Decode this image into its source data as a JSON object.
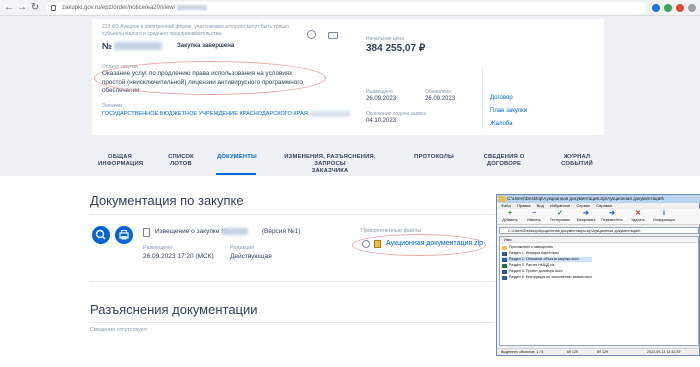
{
  "browser": {
    "url": "zakupki.gov.ru/epz/order/notice/ea20/view/common-info.html?regNumber=",
    "url_visible": "zakupki.gov.ru/epz/order/notice/ea20/view/"
  },
  "notice": {
    "law": "223-ФЗ Аукцион в электронной форме, участниками которого могут быть только субъекты малого и среднего предпринимательства",
    "number_prefix": "№",
    "status": "Закупка завершена",
    "object_label": "Объект закупки",
    "object_text": "Оказание услуг по продлению права использования на условиях простой (неисключительной) лицензии антивирусного программного обеспечения",
    "customer_label": "Заказчик",
    "customer_name": "ГОСУДАРСТВЕННОЕ БЮДЖЕТНОЕ УЧРЕЖДЕНИЕ КРАСНОДАРСКОГО КРАЯ",
    "price_label": "Начальная цена",
    "price": "384 255,07 ₽",
    "placed_label": "Размещено",
    "placed_date": "26.09.2023",
    "updated_label": "Обновлено",
    "updated_date": "26.09.2023",
    "deadline_label": "Окончание подачи заявок",
    "deadline_date": "04.10.2023",
    "links": [
      "Договор",
      "План закупки",
      "Жалоба"
    ]
  },
  "tabs": [
    {
      "l1": "ОБЩАЯ",
      "l2": "ИНФОРМАЦИЯ"
    },
    {
      "l1": "СПИСОК",
      "l2": "ЛОТОВ"
    },
    {
      "l1": "ДОКУМЕНТЫ",
      "l2": ""
    },
    {
      "l1": "ИЗМЕНЕНИЯ, РАЗЪЯСНЕНИЯ, ЗАПРОСЫ",
      "l2": "ЗАКАЗЧИКА"
    },
    {
      "l1": "ПРОТОКОЛЫ",
      "l2": ""
    },
    {
      "l1": "СВЕДЕНИЯ О",
      "l2": "ДОГОВОРЕ"
    },
    {
      "l1": "ЖУРНАЛ",
      "l2": "СОБЫТИЙ"
    }
  ],
  "active_tab": 2,
  "docs": {
    "title": "Документация по закупке",
    "notice_title": "Извещение о закупке №",
    "version": "(Версия №1)",
    "placed_label": "Размещено",
    "placed_value": "26.09.2023 17:20 (МСК)",
    "edition_label": "Редакция",
    "edition_value": "Действующая",
    "attachments_label": "Прикреплённые файлы",
    "attachment": "Аукционная документация.zip"
  },
  "clarifications": {
    "title": "Разъяснения документации",
    "empty": "Сведения отсутствуют"
  },
  "archiver": {
    "title": "C:\\Users\\Desktop\\Аукционная документация.zip\\Аукционная документация\\",
    "menu": [
      "Файл",
      "Правка",
      "Вид",
      "Избранное",
      "Сервис",
      "Справка"
    ],
    "toolbar": [
      "Добавить",
      "Извлечь",
      "Тестировать",
      "Копировать",
      "Переместить",
      "Удалить",
      "Информация"
    ],
    "path": "C:\\Users\\Desktop\\Аукционная документация.zip\\Аукционная документация\\",
    "column": "Имя",
    "files": [
      "Приложение к извещению",
      "Раздел 1. Информ Карта.docx",
      "Раздел 2. Описание объекта закупки.docx",
      "Раздел 3. Расчет НМЦД.xls",
      "Раздел 4. Проект договора.docx",
      "Раздел 5. Инструкция по заполнению заявки.docx"
    ],
    "selected_index": 2,
    "status_selected": "Выделено объектов: 1 / 6",
    "status_size": "69 129",
    "status_packed": "69 129",
    "status_date": "2023-09-14 14:42:39"
  },
  "colors": {
    "accent": "#0065dd",
    "annotation": "#e9a8a8",
    "zip_icon": "#f0b73a"
  }
}
